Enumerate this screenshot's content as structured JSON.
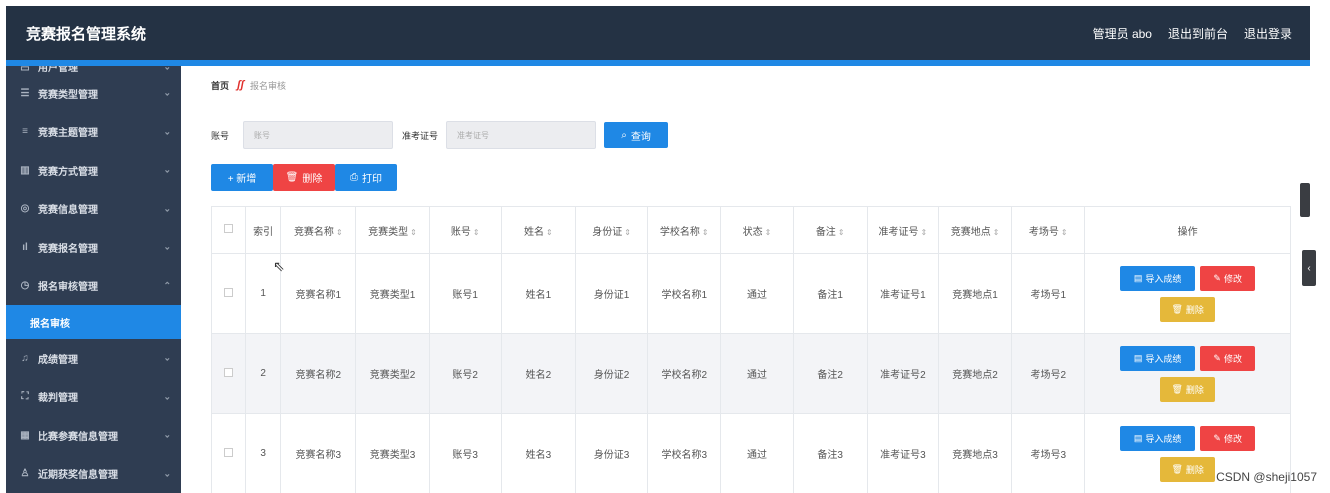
{
  "header": {
    "app_title": "竞赛报名管理系统",
    "admin_label": "管理员 abo",
    "front_link": "退出到前台",
    "logout_link": "退出登录"
  },
  "sidebar": {
    "items": [
      {
        "label": "用户管理",
        "icon": "user-icon"
      },
      {
        "label": "竞赛类型管理",
        "icon": "sliders-icon"
      },
      {
        "label": "竞赛主题管理",
        "icon": "list-icon"
      },
      {
        "label": "竞赛方式管理",
        "icon": "trash-icon"
      },
      {
        "label": "竞赛信息管理",
        "icon": "globe-icon"
      },
      {
        "label": "竞赛报名管理",
        "icon": "bar-chart-icon"
      },
      {
        "label": "报名审核管理",
        "icon": "clock-icon"
      },
      {
        "label": "报名审核",
        "active": true
      },
      {
        "label": "成绩管理",
        "icon": "mic-icon"
      },
      {
        "label": "裁判管理",
        "icon": "frame-icon"
      },
      {
        "label": "比赛参赛信息管理",
        "icon": "barcode-icon"
      },
      {
        "label": "近期获奖信息管理",
        "icon": "person-icon"
      }
    ]
  },
  "breadcrumb": {
    "home": "首页",
    "separator": "ʃʃ",
    "current": "报名审核"
  },
  "search": {
    "account_label": "账号",
    "account_placeholder": "账号",
    "ticket_label": "准考证号",
    "ticket_placeholder": "准考证号",
    "query_button": "查询"
  },
  "toolbar": {
    "add_label": "+ 新增",
    "delete_label": "删除",
    "print_label": "打印"
  },
  "table": {
    "headers": [
      "索引",
      "竞赛名称",
      "竞赛类型",
      "账号",
      "姓名",
      "身份证",
      "学校名称",
      "状态",
      "备注",
      "准考证号",
      "竞赛地点",
      "考场号",
      "操作"
    ],
    "rows": [
      [
        "1",
        "竞赛名称1",
        "竞赛类型1",
        "账号1",
        "姓名1",
        "身份证1",
        "学校名称1",
        "通过",
        "备注1",
        "准考证号1",
        "竞赛地点1",
        "考场号1"
      ],
      [
        "2",
        "竞赛名称2",
        "竞赛类型2",
        "账号2",
        "姓名2",
        "身份证2",
        "学校名称2",
        "通过",
        "备注2",
        "准考证号2",
        "竞赛地点2",
        "考场号2"
      ],
      [
        "3",
        "竞赛名称3",
        "竞赛类型3",
        "账号3",
        "姓名3",
        "身份证3",
        "学校名称3",
        "通过",
        "备注3",
        "准考证号3",
        "竞赛地点3",
        "考场号3"
      ]
    ],
    "import_label": "导入成绩",
    "edit_label": "修改",
    "delete_label": "删除"
  },
  "watermark": "CSDN @sheji1057",
  "colors": {
    "header_bg": "#243244",
    "accent": "#1f88e5",
    "danger": "#ef4444",
    "warning": "#e5b83a",
    "sidebar_bg": "#2f3d52"
  }
}
